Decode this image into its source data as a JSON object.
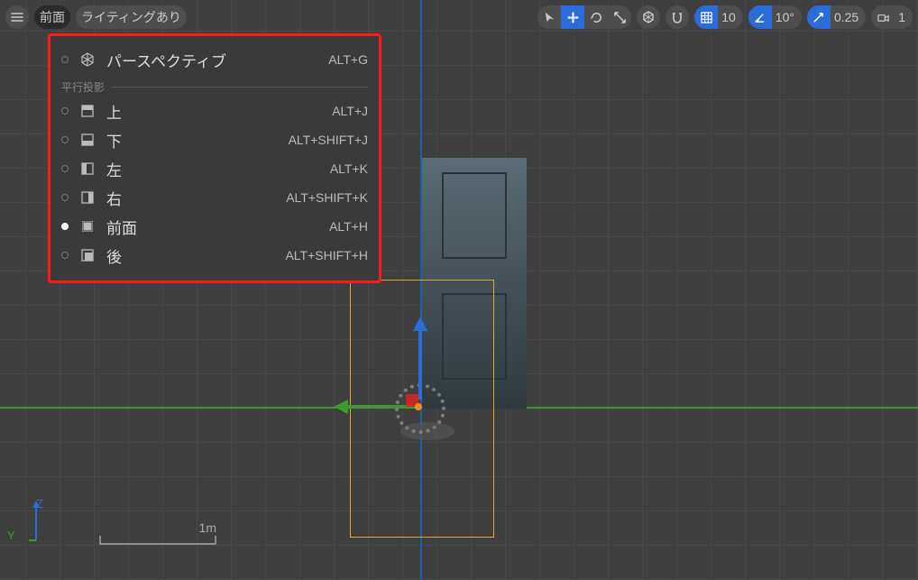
{
  "toolbar": {
    "view_label": "前面",
    "lighting_label": "ライティングあり",
    "grid_value": "10",
    "snap_angle_value": "10°",
    "expand_value": "0.25",
    "camera_value": "1"
  },
  "menu": {
    "items": [
      {
        "label": "パースペクティブ",
        "shortcut": "ALT+G",
        "icon": "cube-icon",
        "selected": false
      }
    ],
    "section_label": "平行投影",
    "ortho": [
      {
        "label": "上",
        "shortcut": "ALT+J",
        "icon": "top-icon",
        "selected": false
      },
      {
        "label": "下",
        "shortcut": "ALT+SHIFT+J",
        "icon": "bottom-icon",
        "selected": false
      },
      {
        "label": "左",
        "shortcut": "ALT+K",
        "icon": "left-icon",
        "selected": false
      },
      {
        "label": "右",
        "shortcut": "ALT+SHIFT+K",
        "icon": "right-icon",
        "selected": false
      },
      {
        "label": "前面",
        "shortcut": "ALT+H",
        "icon": "front-icon",
        "selected": true
      },
      {
        "label": "後",
        "shortcut": "ALT+SHIFT+H",
        "icon": "back-icon",
        "selected": false
      }
    ]
  },
  "axis": {
    "z": "Z",
    "y": "Y"
  },
  "scalebar": {
    "unit": "1m"
  }
}
